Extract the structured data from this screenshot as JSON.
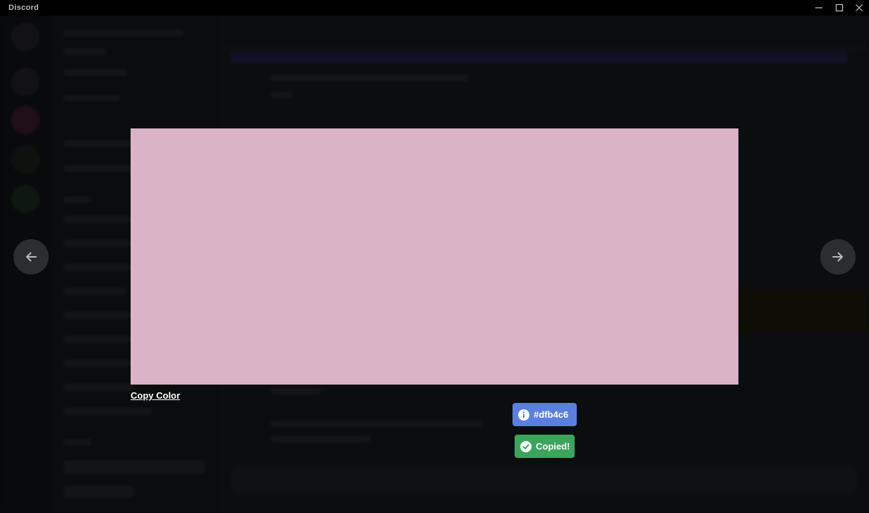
{
  "window": {
    "title": "Discord",
    "controls": {
      "minimize": "minimize-icon",
      "maximize": "maximize-icon",
      "close": "close-icon"
    }
  },
  "viewer": {
    "color_hex": "#dfb4c6",
    "copy_label": "Copy Color",
    "prev_icon": "arrow-left-icon",
    "next_icon": "arrow-right-icon"
  },
  "toasts": [
    {
      "type": "info",
      "icon": "info-icon",
      "text": "#dfb4c6",
      "color": "#5b7fe0"
    },
    {
      "type": "success",
      "icon": "check-circle-icon",
      "text": "Copied!",
      "color": "#3ba55d"
    }
  ],
  "colors": {
    "preview": "#dbb3c6",
    "backdrop": "#0b0c0e",
    "nav_button": "#2b2d31"
  }
}
